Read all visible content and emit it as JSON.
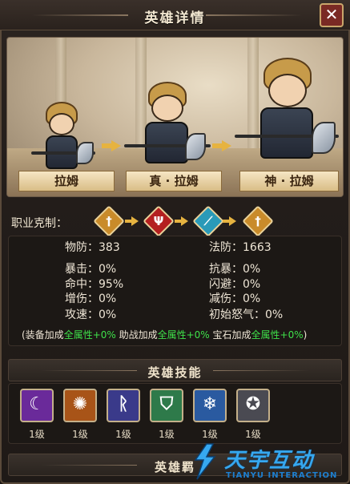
{
  "window": {
    "title": "英雄详情",
    "close_glyph": "✕"
  },
  "heroes": [
    {
      "name": "拉姆"
    },
    {
      "name": "真 · 拉姆"
    },
    {
      "name": "神 · 拉姆"
    }
  ],
  "class_restraint": {
    "label": "职业克制：",
    "icons": [
      {
        "name": "sword-class-icon",
        "color": "#c98b2a"
      },
      {
        "name": "demon-class-icon",
        "color": "#b42020"
      },
      {
        "name": "magic-class-icon",
        "color": "#2a9ab8"
      },
      {
        "name": "sword-class-icon",
        "color": "#c98b2a"
      }
    ]
  },
  "stats": {
    "left": [
      {
        "label": "物防：",
        "value": "383"
      },
      {
        "label": "暴击：",
        "value": "0%"
      },
      {
        "label": "命中：",
        "value": "95%"
      },
      {
        "label": "增伤：",
        "value": "0%"
      },
      {
        "label": "攻速：",
        "value": "0%"
      }
    ],
    "right": [
      {
        "label": "法防：",
        "value": "1663"
      },
      {
        "label": "抗暴：",
        "value": "0%"
      },
      {
        "label": "闪避：",
        "value": "0%"
      },
      {
        "label": "减伤：",
        "value": "0%"
      },
      {
        "label": "初始怒气：",
        "value": "0%"
      }
    ],
    "bonus": {
      "open": "(装备加成",
      "equip_value": "全属性+0%",
      "assist_label": " 助战加成",
      "assist_value": "全属性+0%",
      "gem_label": " 宝石加成",
      "gem_value": "全属性+0%",
      "close": ")"
    }
  },
  "skills_section": {
    "title": "英雄技能"
  },
  "skills": [
    {
      "icon": "crescent-slash-icon",
      "level": "1级",
      "color": "#6a2a9a"
    },
    {
      "icon": "flame-burst-icon",
      "level": "1级",
      "color": "#a85418"
    },
    {
      "icon": "arcane-rune-icon",
      "level": "1级",
      "color": "#3a3a8a"
    },
    {
      "icon": "shield-icon",
      "level": "1级",
      "color": "#2e7a4a"
    },
    {
      "icon": "ice-burst-icon",
      "level": "1级",
      "color": "#2a5aa0"
    },
    {
      "icon": "pentagram-icon",
      "level": "1级",
      "color": "#4a4a52"
    }
  ],
  "next_section": {
    "title": "英雄羁"
  },
  "watermark": {
    "cn": "天宇互动",
    "en": "TIANYU INTERACTION"
  }
}
